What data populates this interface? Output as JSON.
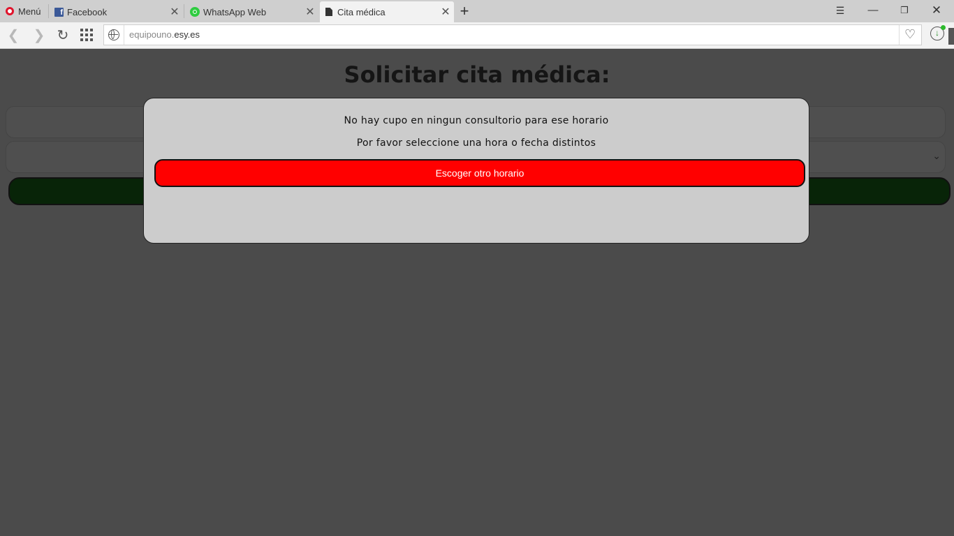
{
  "browser": {
    "menu_label": "Menú",
    "tabs": [
      {
        "label": "Facebook",
        "icon": "facebook-icon"
      },
      {
        "label": "WhatsApp Web",
        "icon": "whatsapp-icon"
      },
      {
        "label": "Cita médica",
        "icon": "document-icon",
        "active": true
      }
    ],
    "address": {
      "subdomain": "equipouno.",
      "domain": "esy.es"
    }
  },
  "page": {
    "title": "Solicitar cita médica:"
  },
  "modal": {
    "message_line1": "No hay cupo en ningun consultorio para ese horario",
    "message_line2": "Por favor seleccione una hora o fecha distintos",
    "button_label": "Escoger otro horario",
    "button_color": "#ff0000"
  },
  "colors": {
    "overlay": "#4b4b4b",
    "submit_bar": "#082408",
    "modal_bg": "#cccccc"
  }
}
